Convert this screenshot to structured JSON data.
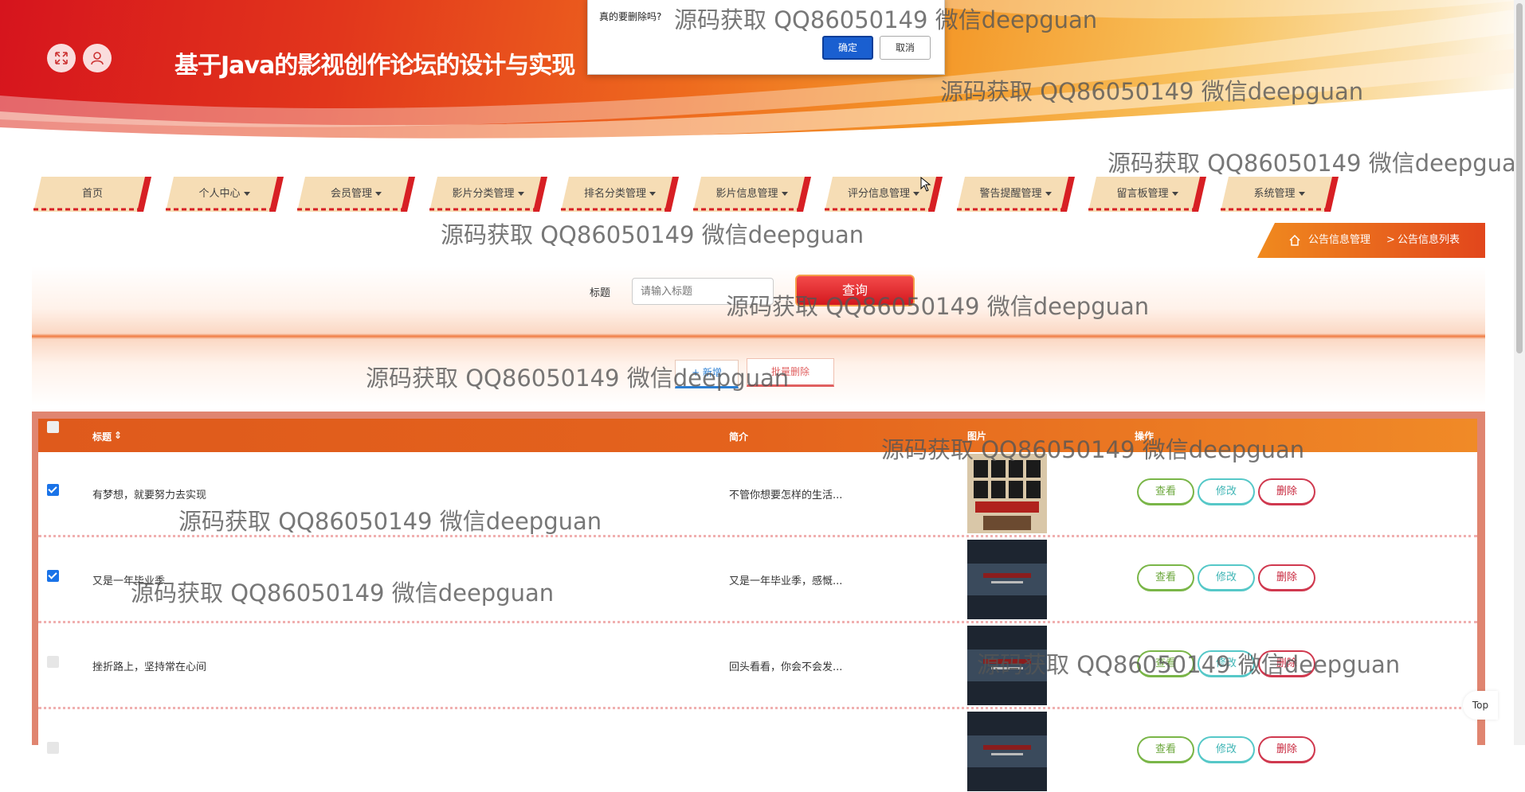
{
  "header": {
    "site_title": "基于Java的影视创作论坛的设计与实现",
    "fullscreen_icon": "expand-icon",
    "user_icon": "user-icon"
  },
  "nav": {
    "items": [
      {
        "label": "首页",
        "dropdown": false
      },
      {
        "label": "个人中心",
        "dropdown": true
      },
      {
        "label": "会员管理",
        "dropdown": true
      },
      {
        "label": "影片分类管理",
        "dropdown": true
      },
      {
        "label": "排名分类管理",
        "dropdown": true
      },
      {
        "label": "影片信息管理",
        "dropdown": true
      },
      {
        "label": "评分信息管理",
        "dropdown": true
      },
      {
        "label": "警告提醒管理",
        "dropdown": true
      },
      {
        "label": "留言板管理",
        "dropdown": true
      },
      {
        "label": "系统管理",
        "dropdown": true
      }
    ]
  },
  "breadcrumb": {
    "home_icon": "home-icon",
    "section": "公告信息管理",
    "separator": ">",
    "page": "公告信息列表"
  },
  "search": {
    "label": "标题",
    "placeholder": "请输入标题",
    "value": "",
    "query_button": "查询"
  },
  "toolbar": {
    "add_label": "+ 新增",
    "batch_delete_label": "批量删除"
  },
  "table": {
    "columns": {
      "title": "标题",
      "summary": "简介",
      "image": "图片",
      "actions": "操作"
    },
    "rows": [
      {
        "checked": true,
        "title": "有梦想，就要努力去实现",
        "summary": "不管你想要怎样的生活..."
      },
      {
        "checked": true,
        "title": "又是一年毕业季",
        "summary": "又是一年毕业季，感慨..."
      },
      {
        "checked": false,
        "title": "挫折路上，坚持常在心间",
        "summary": "回头看看，你会不会发..."
      },
      {
        "checked": false,
        "title": "",
        "summary": ""
      }
    ],
    "actions": {
      "view": "查看",
      "edit": "修改",
      "delete": "删除"
    }
  },
  "dialog": {
    "message": "真的要删除吗?",
    "ok": "确定",
    "cancel": "取消"
  },
  "back_to_top": "Top",
  "watermarks": [
    "源码获取 QQ86050149 微信deepguan"
  ],
  "colors": {
    "primary_red": "#d6141d",
    "orange": "#ef7a1e",
    "dialog_ok": "#1a5fd0",
    "view": "#7ab648",
    "edit": "#56c8c8",
    "delete": "#d0394f"
  }
}
